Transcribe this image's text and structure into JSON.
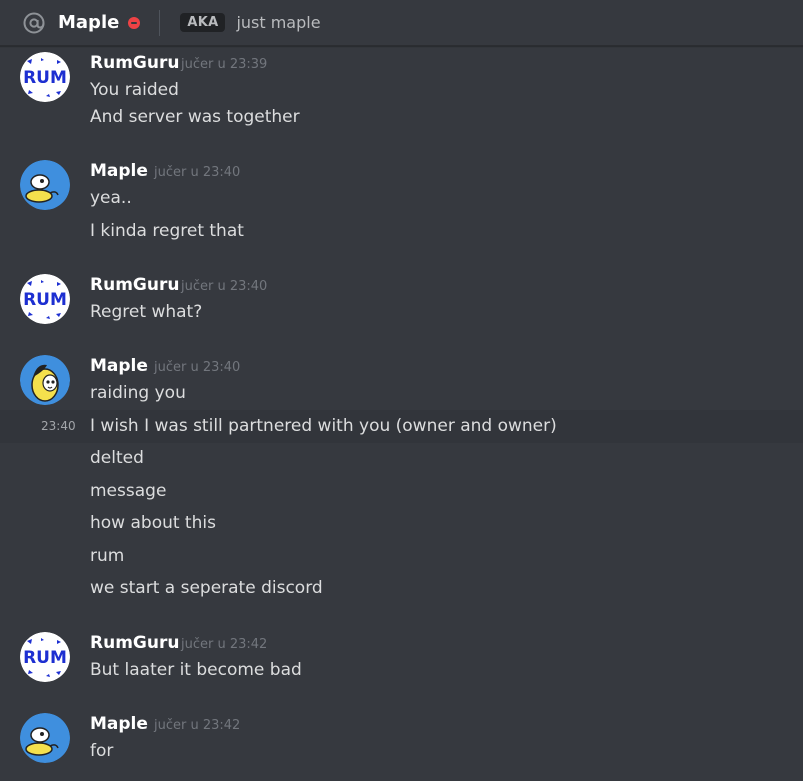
{
  "header": {
    "name": "Maple",
    "aka_badge": "AKA",
    "aka_value": "just maple",
    "status": "do-not-disturb",
    "status_color": "#ed4245"
  },
  "messages": [
    {
      "author": "RumGuru",
      "timestamp": "jučer u 23:39",
      "avatar": "rum-logo-avatar",
      "lines": [
        "You raided",
        "And server was together"
      ]
    },
    {
      "author": "Maple",
      "timestamp": "jučer u 23:40",
      "avatar": "cartoon-character-avatar",
      "lines": [
        "yea..",
        "I kinda regret that"
      ]
    },
    {
      "author": "RumGuru",
      "timestamp": "jučer u 23:40",
      "avatar": "rum-logo-avatar",
      "lines": [
        "Regret what?"
      ]
    },
    {
      "author": "Maple",
      "timestamp": "jučer u 23:40",
      "avatar": "cartoon-character-avatar",
      "lines": [
        "raiding you",
        "I wish I was still partnered with you (owner and owner)",
        "delted",
        "message",
        "how about this",
        "rum",
        "we start a seperate discord"
      ],
      "hover_time": "23:40"
    },
    {
      "author": "RumGuru",
      "timestamp": "jučer u 23:42",
      "avatar": "rum-logo-avatar",
      "lines": [
        "But laater it become bad"
      ]
    },
    {
      "author": "Maple",
      "timestamp": "jučer u 23:42",
      "avatar": "cartoon-character-avatar",
      "lines": [
        "for"
      ]
    }
  ]
}
